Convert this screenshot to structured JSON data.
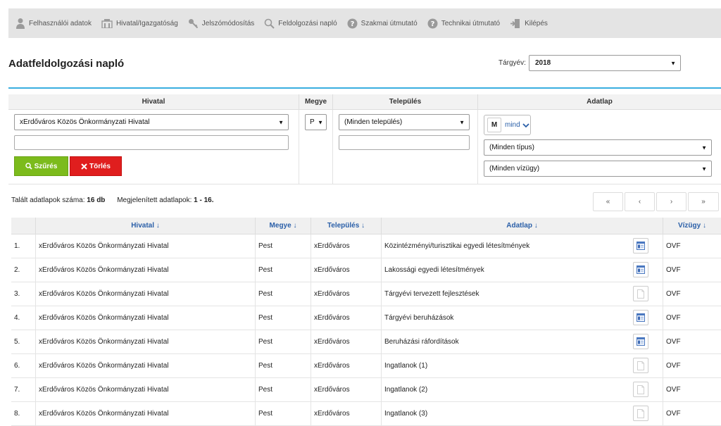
{
  "nav": {
    "items": [
      {
        "label": "Felhasználói adatok",
        "icon": "user-icon"
      },
      {
        "label": "Hivatal/Igazgatóság",
        "icon": "building-icon"
      },
      {
        "label": "Jelszómódosítás",
        "icon": "key-icon"
      },
      {
        "label": "Feldolgozási napló",
        "icon": "magnifier-icon"
      },
      {
        "label": "Szakmai útmutató",
        "icon": "question-icon"
      },
      {
        "label": "Technikai útmutató",
        "icon": "question-icon"
      },
      {
        "label": "Kilépés",
        "icon": "exit-icon"
      }
    ]
  },
  "page": {
    "title": "Adatfeldolgozási napló",
    "year_label": "Tárgyév:",
    "year_value": "2018"
  },
  "filters": {
    "headers": {
      "hivatal": "Hivatal",
      "megye": "Megye",
      "telepules": "Település",
      "adatlap": "Adatlap"
    },
    "hivatal_value": "xErdőváros Közös Önkormányzati Hivatal",
    "megye_value": "P",
    "telepules_value": "(Minden település)",
    "m_letter": "M",
    "m_text": "mind",
    "tipus_value": "(Minden típus)",
    "vizugy_value": "(Minden vízügy)",
    "filter_button": "Szűrés",
    "clear_button": "Törlés"
  },
  "summary": {
    "found_label": "Talált adatlapok száma:",
    "found_value": "16 db",
    "shown_label": "Megjelenített adatlapok:",
    "shown_value": "1 - 16."
  },
  "pager": {
    "first": "«",
    "prev": "‹",
    "next": "›",
    "last": "»"
  },
  "table": {
    "headers": {
      "hivatal": "Hivatal",
      "megye": "Megye",
      "telepules": "Település",
      "adatlap": "Adatlap",
      "vizugy": "Vízügy"
    },
    "sort_arrow": "↓",
    "rows": [
      {
        "num": "1.",
        "hivatal": "xErdőváros Közös Önkormányzati Hivatal",
        "megye": "Pest",
        "telepules": "xErdőváros",
        "adatlap": "Közintézményi/turisztikai egyedi létesítmények",
        "icon": "form-icon",
        "vizugy": "OVF"
      },
      {
        "num": "2.",
        "hivatal": "xErdőváros Közös Önkormányzati Hivatal",
        "megye": "Pest",
        "telepules": "xErdőváros",
        "adatlap": "Lakossági egyedi létesítmények",
        "icon": "form-icon",
        "vizugy": "OVF"
      },
      {
        "num": "3.",
        "hivatal": "xErdőváros Közös Önkormányzati Hivatal",
        "megye": "Pest",
        "telepules": "xErdőváros",
        "adatlap": "Tárgyévi tervezett fejlesztések",
        "icon": "blank-document-icon",
        "vizugy": "OVF"
      },
      {
        "num": "4.",
        "hivatal": "xErdőváros Közös Önkormányzati Hivatal",
        "megye": "Pest",
        "telepules": "xErdőváros",
        "adatlap": "Tárgyévi beruházások",
        "icon": "form-icon",
        "vizugy": "OVF"
      },
      {
        "num": "5.",
        "hivatal": "xErdőváros Közös Önkormányzati Hivatal",
        "megye": "Pest",
        "telepules": "xErdőváros",
        "adatlap": "Beruházási ráfordítások",
        "icon": "form-icon",
        "vizugy": "OVF"
      },
      {
        "num": "6.",
        "hivatal": "xErdőváros Közös Önkormányzati Hivatal",
        "megye": "Pest",
        "telepules": "xErdőváros",
        "adatlap": "Ingatlanok (1)",
        "icon": "blank-document-icon",
        "vizugy": "OVF"
      },
      {
        "num": "7.",
        "hivatal": "xErdőváros Közös Önkormányzati Hivatal",
        "megye": "Pest",
        "telepules": "xErdőváros",
        "adatlap": "Ingatlanok (2)",
        "icon": "blank-document-icon",
        "vizugy": "OVF"
      },
      {
        "num": "8.",
        "hivatal": "xErdőváros Közös Önkormányzati Hivatal",
        "megye": "Pest",
        "telepules": "xErdőváros",
        "adatlap": "Ingatlanok (3)",
        "icon": "blank-document-icon",
        "vizugy": "OVF"
      }
    ]
  }
}
